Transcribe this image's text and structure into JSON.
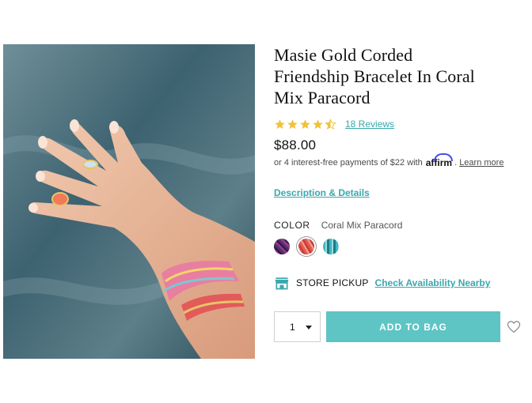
{
  "product": {
    "image_alt": "Hand wearing corded friendship bracelets over water",
    "title_line1": "Masie Gold Corded",
    "title_line2": "Friendship Bracelet In Coral",
    "title_line3": "Mix Paracord",
    "rating": 4.5,
    "reviews_link": "18 Reviews",
    "price": "$88.00",
    "installments_text": "or 4 interest-free payments of $22 with",
    "affirm_logo": "affirm",
    "learn_more": "Learn more",
    "description_link": "Description & Details"
  },
  "color": {
    "label": "COLOR",
    "selected": "Coral Mix Paracord",
    "swatches": [
      "purple-mix",
      "coral-mix",
      "teal-mix"
    ]
  },
  "pickup": {
    "label": "STORE PICKUP",
    "check_link": "Check Availability Nearby",
    "icon": "store-icon"
  },
  "purchase": {
    "quantity": "1",
    "add_button": "ADD TO BAG",
    "wishlist_icon": "heart-icon"
  },
  "colors": {
    "accent": "#3aa7ad",
    "button": "#5ec4c4",
    "star": "#f2c23a"
  }
}
